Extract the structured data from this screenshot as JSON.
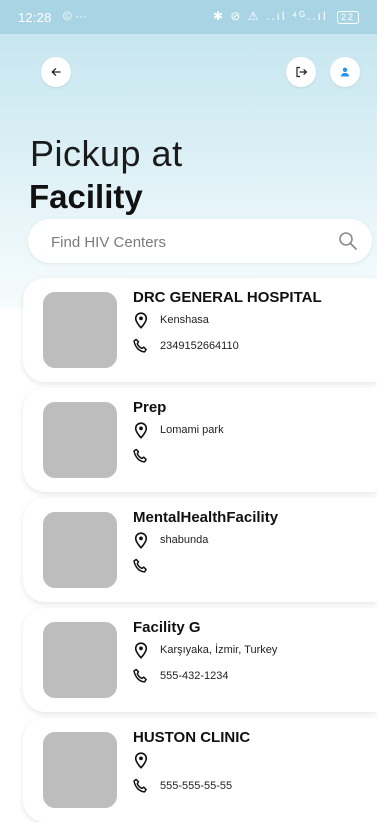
{
  "status_bar": {
    "time": "12:28",
    "left_icons": "© ···",
    "right_icons": "✱ ⊘ ⚠ ..ıl ⁴ᴳ..ıl",
    "battery": "22"
  },
  "header": {
    "title_light": "Pickup at",
    "title_bold": "Facility"
  },
  "search": {
    "placeholder": "Find HIV Centers"
  },
  "facilities": [
    {
      "name": "DRC GENERAL HOSPITAL",
      "address": "Kenshasa",
      "phone": "2349152664110"
    },
    {
      "name": "Prep",
      "address": "Lomami park",
      "phone": ""
    },
    {
      "name": "MentalHealthFacility",
      "address": "shabunda",
      "phone": ""
    },
    {
      "name": "Facility G",
      "address": "Karşıyaka, İzmir, Turkey",
      "phone": "555-432-1234"
    },
    {
      "name": "HUSTON CLINIC",
      "address": "",
      "phone": "555-555-55-55"
    }
  ],
  "colors": {
    "accent": "#2196f3",
    "thumbnail": "#bdbdbd",
    "hero_top": "#c7e6f0"
  },
  "icons": {
    "back": "arrow-left-icon",
    "logout": "logout-icon",
    "profile": "person-icon",
    "search": "search-icon",
    "location": "location-pin-icon",
    "phone": "phone-icon"
  }
}
